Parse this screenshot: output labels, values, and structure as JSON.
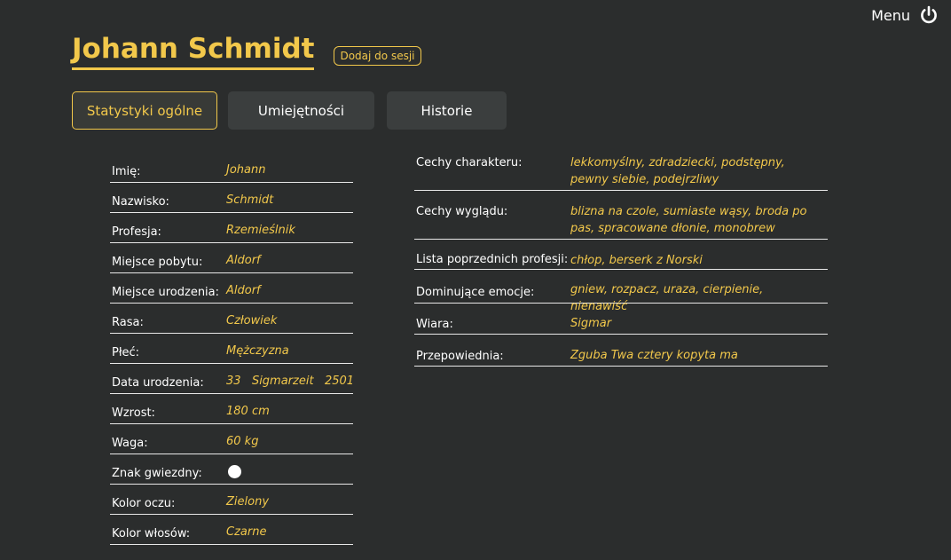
{
  "header": {
    "menu_label": "Menu",
    "power_icon": "power-icon"
  },
  "character": {
    "name": "Johann Schmidt",
    "add_to_session_label": "Dodaj do sesji"
  },
  "tabs": [
    {
      "label": "Statystyki ogólne",
      "active": true
    },
    {
      "label": "Umiejętności",
      "active": false
    },
    {
      "label": "Historie",
      "active": false
    }
  ],
  "general_stats": [
    {
      "label": "Imię:",
      "value": "Johann"
    },
    {
      "label": "Nazwisko:",
      "value": "Schmidt"
    },
    {
      "label": "Profesja:",
      "value": "Rzemieślnik"
    },
    {
      "label": "Miejsce pobytu:",
      "value": "Aldorf"
    },
    {
      "label": "Miejsce urodzenia:",
      "value": "Aldorf"
    },
    {
      "label": "Rasa:",
      "value": "Człowiek"
    },
    {
      "label": "Płeć:",
      "value": "Mężczyzna"
    },
    {
      "label": "Data urodzenia:",
      "value": "33   Sigmarzeit   2501"
    },
    {
      "label": "Wzrost:",
      "value": "180 cm"
    },
    {
      "label": "Waga:",
      "value": "60 kg"
    },
    {
      "label": "Znak gwiezdny:",
      "value": "",
      "icon": "white-circle-icon"
    },
    {
      "label": "Kolor oczu:",
      "value": "Zielony"
    },
    {
      "label": "Kolor włosów:",
      "value": "Czarne"
    }
  ],
  "traits": [
    {
      "label": "Cechy charakteru:",
      "value": "lekkomyślny, zdradziecki, podstępny, pewny siebie, podejrzliwy"
    },
    {
      "label": "Cechy wyglądu:",
      "value": "blizna na czole, sumiaste wąsy, broda po pas, spracowane dłonie, monobrew"
    },
    {
      "label": "Lista poprzednich profesji:",
      "value": "chłop, berserk z Norski"
    },
    {
      "label": "Dominujące emocje:",
      "value": "gniew, rozpacz, uraza, cierpienie, nienawiść"
    },
    {
      "label": "Wiara:",
      "value": "Sigmar"
    },
    {
      "label": "Przepowiednia:",
      "value": "Zguba Twa cztery kopyta ma"
    }
  ],
  "colors": {
    "background": "#2b2d2d",
    "accent": "#f2c84b",
    "tab_background": "#3b3e3e",
    "text": "#ffffff"
  }
}
